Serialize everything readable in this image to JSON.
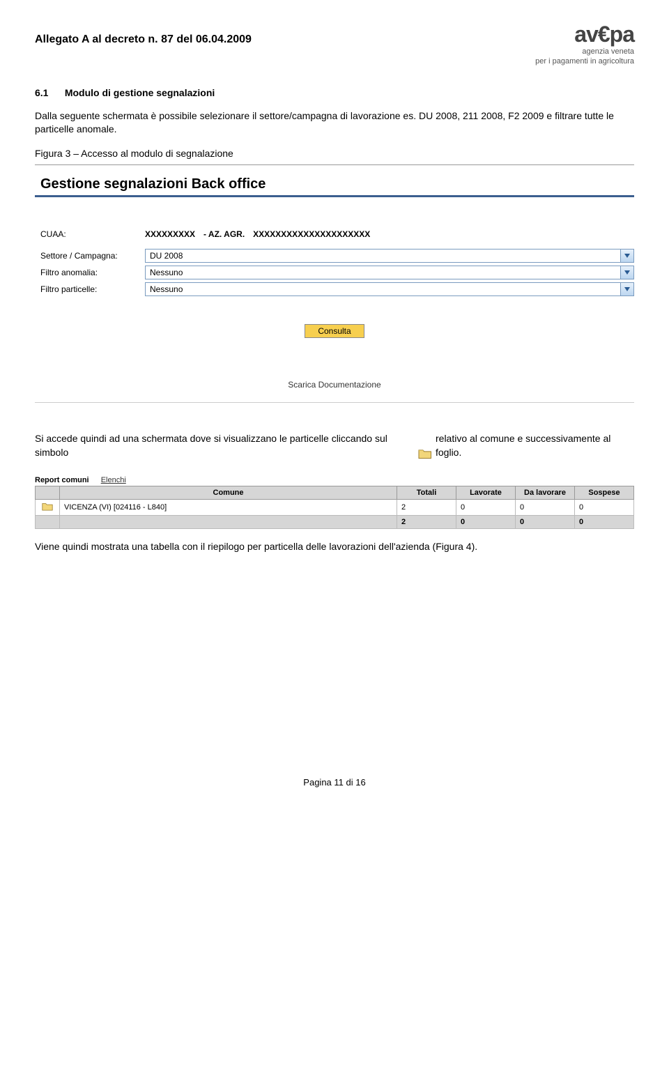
{
  "header": {
    "title": "Allegato A al decreto n.  87 del 06.04.2009",
    "logo_main": "av€pa",
    "logo_sub1": "agenzia veneta",
    "logo_sub2": "per i pagamenti in agricoltura"
  },
  "section": {
    "number": "6.1",
    "title": "Modulo di gestione segnalazioni"
  },
  "para1": "Dalla seguente schermata è possibile selezionare il settore/campagna di lavorazione es. DU 2008, 211 2008, F2 2009 e filtrare tutte le particelle anomale.",
  "fig3_caption": "Figura 3 – Accesso al modulo di segnalazione",
  "form": {
    "title": "Gestione segnalazioni Back office",
    "cuaa_label": "CUAA:",
    "cuaa_value": "XXXXXXXXX",
    "cuaa_sep": "- AZ. AGR.",
    "cuaa_name": "XXXXXXXXXXXXXXXXXXXXX",
    "settore_label": "Settore / Campagna:",
    "settore_value": "DU 2008",
    "filtro_anom_label": "Filtro anomalia:",
    "filtro_anom_value": "Nessuno",
    "filtro_part_label": "Filtro particelle:",
    "filtro_part_value": "Nessuno",
    "consulta_label": "Consulta",
    "scarica_label": "Scarica Documentazione"
  },
  "para2_a": "Si accede quindi ad una schermata dove si visualizzano le particelle cliccando sul simbolo",
  "para2_b": "relativo al comune e successivamente al foglio.",
  "report": {
    "tab_active": "Report comuni",
    "tab_inactive": "Elenchi",
    "headers": {
      "comune": "Comune",
      "totali": "Totali",
      "lavorate": "Lavorate",
      "da_lavorare": "Da lavorare",
      "sospese": "Sospese"
    },
    "rows": [
      {
        "comune": "VICENZA (VI) [024116 - L840]",
        "totali": "2",
        "lavorate": "0",
        "da_lavorare": "0",
        "sospese": "0"
      }
    ],
    "total_row": {
      "comune": "",
      "totali": "2",
      "lavorate": "0",
      "da_lavorare": "0",
      "sospese": "0"
    }
  },
  "para3": "Viene quindi mostrata una tabella con il riepilogo per particella delle lavorazioni dell'azienda (Figura 4).",
  "page_number": "Pagina 11 di 16"
}
